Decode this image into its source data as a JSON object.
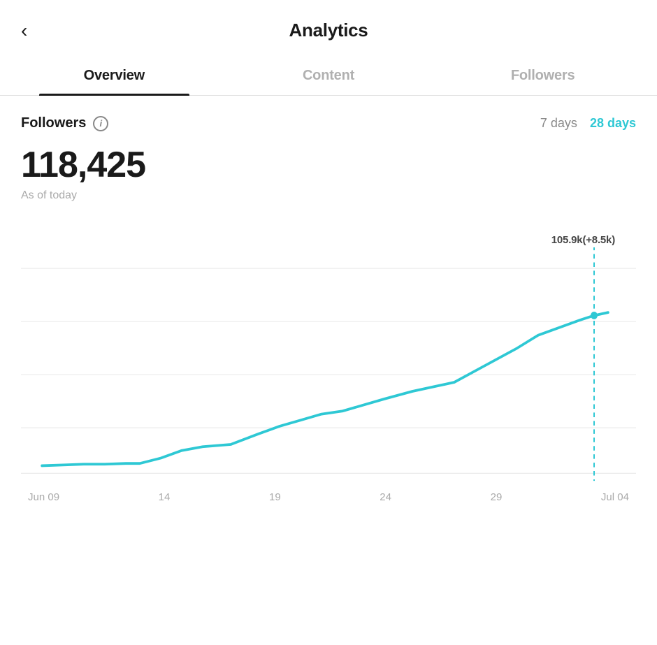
{
  "header": {
    "back_label": "‹",
    "title": "Analytics"
  },
  "tabs": [
    {
      "id": "overview",
      "label": "Overview",
      "active": true
    },
    {
      "id": "content",
      "label": "Content",
      "active": false
    },
    {
      "id": "followers",
      "label": "Followers",
      "active": false
    }
  ],
  "section": {
    "followers_label": "Followers",
    "info_icon": "i",
    "days_options": [
      {
        "label": "7 days",
        "active": false
      },
      {
        "label": "28 days",
        "active": true
      }
    ],
    "count": "118,425",
    "subtitle": "As of today",
    "tooltip": "105.9k(+8.5k)",
    "x_labels": [
      "Jun 09",
      "14",
      "19",
      "24",
      "29",
      "Jul 04"
    ],
    "accent_color": "#2ec8d4",
    "line_color": "#2ec8d4"
  }
}
